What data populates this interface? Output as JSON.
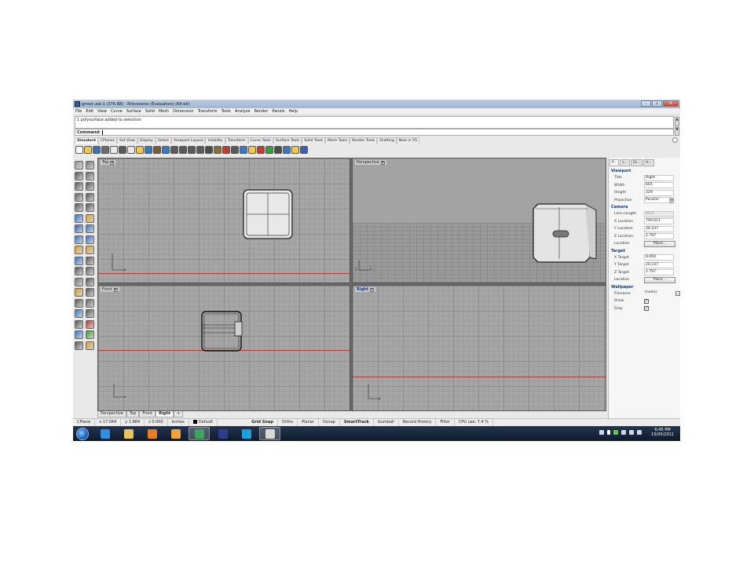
{
  "window": {
    "title": "gmod usb-1 (376 KB) - Rhinoceros (Evaluation) (64-bit)",
    "controls": [
      "–",
      "▫",
      "X"
    ]
  },
  "menu": [
    "File",
    "Edit",
    "View",
    "Curve",
    "Surface",
    "Solid",
    "Mesh",
    "Dimension",
    "Transform",
    "Tools",
    "Analyze",
    "Render",
    "Panels",
    "Help"
  ],
  "command": {
    "history": "1 polysurface added to selection",
    "prompt_label": "Command:"
  },
  "toolbar_tabs": [
    "Standard",
    "CPlanes",
    "Set View",
    "Display",
    "Select",
    "Viewport Layout",
    "Visibility",
    "Transform",
    "Curve Tools",
    "Surface Tools",
    "Solid Tools",
    "Mesh Tools",
    "Render Tools",
    "Drafting",
    "New in V5"
  ],
  "toolbar_icons": [
    "new-file-icon",
    "open-file-icon",
    "save-icon",
    "print-icon",
    "import-icon",
    "cut-icon",
    "copy-icon",
    "paste-icon",
    "undo-icon",
    "pan-icon",
    "rotate-icon",
    "zoom-icon",
    "zoom-window-icon",
    "zoom-extents-icon",
    "zoom-selected-icon",
    "four-view-icon",
    "grid-icon",
    "select-icon",
    "points-icon",
    "curve-icon",
    "light-icon",
    "render-icon",
    "material-icon",
    "sphere-icon",
    "shaded-icon",
    "rendered-icon",
    "help-icon"
  ],
  "toolbar_colors": [
    "#ffffff",
    "#f2c84b",
    "#3d6fb5",
    "#6b6b6b",
    "#e9e9e9",
    "#5a5a5a",
    "#e9e9e9",
    "#f2c84b",
    "#3b78c4",
    "#7b5c3a",
    "#3b78c4",
    "#5a5a5a",
    "#5a5a5a",
    "#5a5a5a",
    "#5a5a5a",
    "#4c4c4c",
    "#8a6b3a",
    "#c33b2e",
    "#5a5a5a",
    "#3b78c4",
    "#f2c84b",
    "#c33b2e",
    "#3b9b3b",
    "#4c4c4c",
    "#3b78c4",
    "#f2c84b",
    "#3b5fb8"
  ],
  "palette_colors": [
    "#9a9a9a",
    "#7a7a7a",
    "#5a5a5a",
    "#6a6a6a",
    "#5a5a5a",
    "#5a5a5a",
    "#666666",
    "#5a5a5a",
    "#5a5a5a",
    "#5a5a5a",
    "#3b78c4",
    "#d8a23b",
    "#3b5fb8",
    "#3b78c4",
    "#3b78c4",
    "#3b78c4",
    "#e0a030",
    "#d8a23b",
    "#3b78c4",
    "#5a5a5a",
    "#5a5a5a",
    "#6a6a6a",
    "#7a7a7a",
    "#5a5a5a",
    "#d8a23b",
    "#5a5a5a",
    "#5a5a5a",
    "#6a6a6a",
    "#3b78c4",
    "#5a5a5a",
    "#5a5a5a",
    "#c33b2e",
    "#3b78c4",
    "#3b9b3b",
    "#5a5a5a",
    "#d8a23b"
  ],
  "viewports": {
    "top": "Top",
    "perspective": "Perspective",
    "front": "Front",
    "right": "Right"
  },
  "viewport_tabs": [
    "Perspective",
    "Top",
    "Front",
    "Right"
  ],
  "panel": {
    "tabs": [
      "P...",
      "L...",
      "Di...",
      "H..."
    ],
    "viewport_header": "Viewport",
    "viewport_rows": [
      {
        "k": "Title",
        "v": "Right"
      },
      {
        "k": "Width",
        "v": "665"
      },
      {
        "k": "Height",
        "v": "329"
      },
      {
        "k": "Projection",
        "v": "Parallel"
      }
    ],
    "camera_header": "Camera",
    "camera_rows": [
      {
        "k": "Lens Length",
        "v": "50.0"
      },
      {
        "k": "X Location",
        "v": "790.611"
      },
      {
        "k": "Y Location",
        "v": "20.237"
      },
      {
        "k": "Z Location",
        "v": "2.797"
      }
    ],
    "camera_location_label": "Location",
    "place_button": "Place...",
    "target_header": "Target",
    "target_rows": [
      {
        "k": "X Target",
        "v": "0.000"
      },
      {
        "k": "Y Target",
        "v": "20.237"
      },
      {
        "k": "Z Target",
        "v": "2.797"
      }
    ],
    "target_location_label": "Location",
    "wallpaper_header": "Wallpaper",
    "wallpaper_filename_label": "Filename",
    "wallpaper_filename": "(none)",
    "wallpaper_show_label": "Show",
    "wallpaper_gray_label": "Gray"
  },
  "status": {
    "cplane": "CPlane",
    "x": "x 17.044",
    "y": "y 1.884",
    "z": "z 0.000",
    "units": "Inches",
    "layer": "Default",
    "toggles": [
      "Grid Snap",
      "Ortho",
      "Planar",
      "Osnap",
      "SmartTrack",
      "Gumball",
      "Record History",
      "Filter"
    ],
    "cpu": "CPU use: 7.4 %"
  },
  "taskbar": {
    "apps": [
      {
        "name": "internet-explorer-icon",
        "color": "#2f8fe0"
      },
      {
        "name": "file-explorer-icon",
        "color": "#e8c45a"
      },
      {
        "name": "media-player-icon",
        "color": "#e67e22"
      },
      {
        "name": "sun-app-icon",
        "color": "#f2a23b"
      },
      {
        "name": "chrome-icon",
        "color": "#3da55d"
      },
      {
        "name": "rhino-icon",
        "color": "#2c3e8c"
      },
      {
        "name": "skype-icon",
        "color": "#1ba1e2"
      },
      {
        "name": "rhino-app-icon",
        "color": "#d9d9d9"
      }
    ],
    "time": "6:45 PM",
    "date": "15/05/2011"
  }
}
